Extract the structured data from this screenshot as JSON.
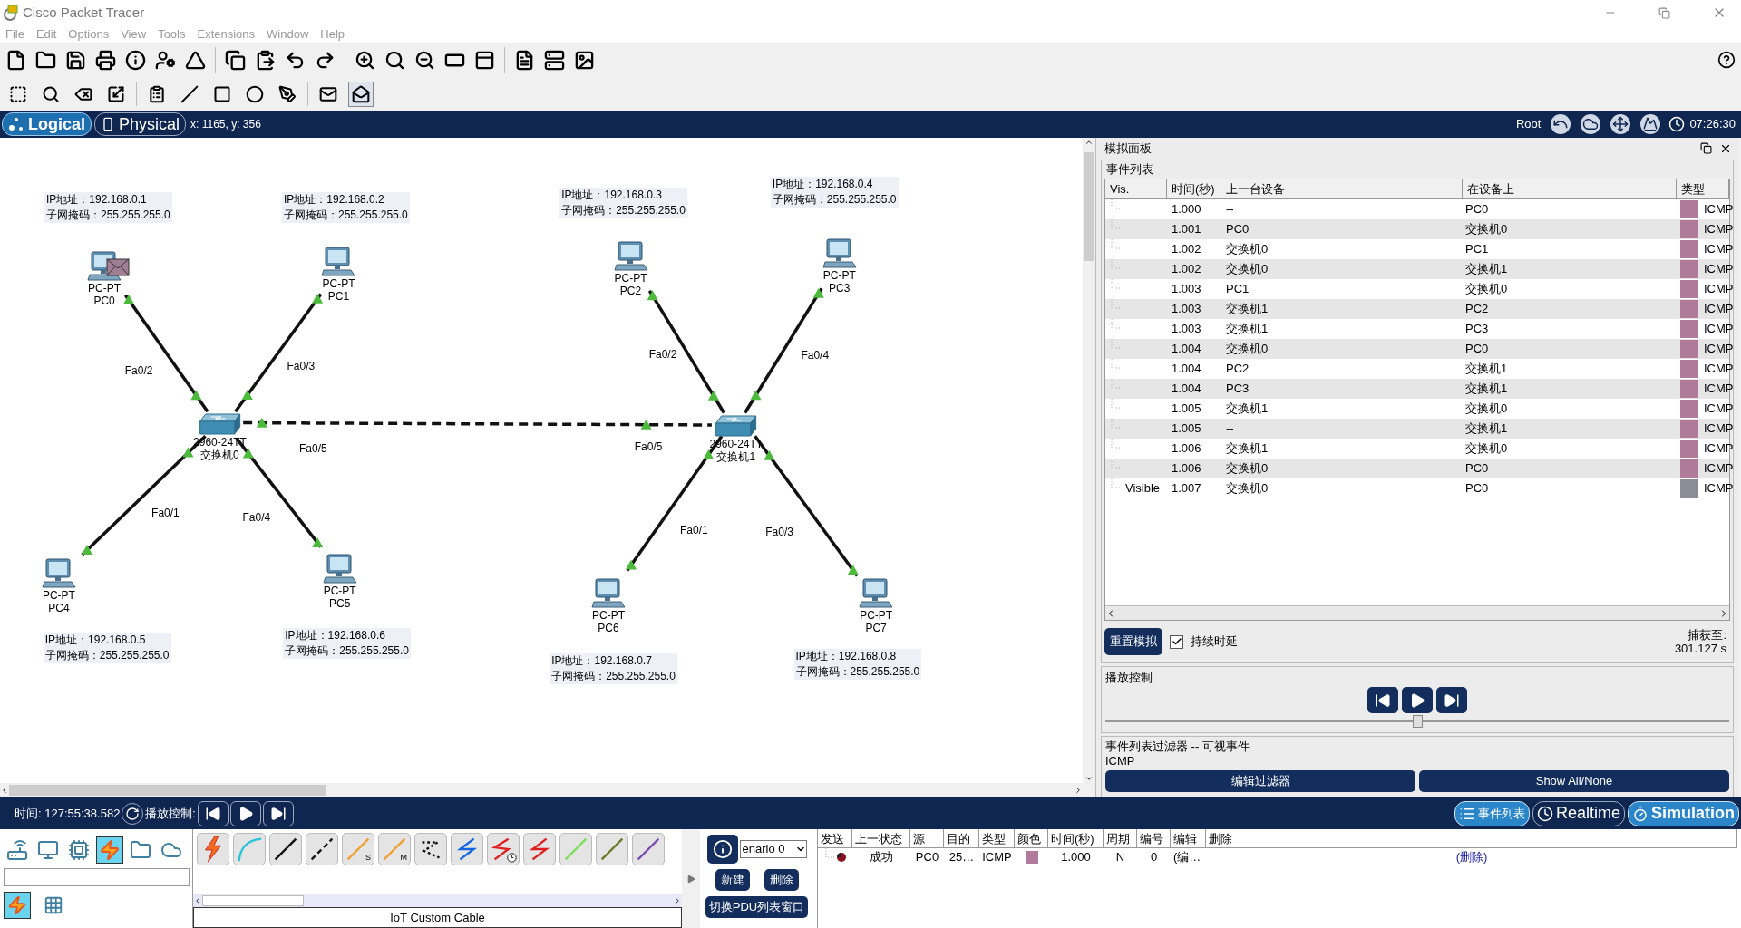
{
  "window": {
    "title": "Cisco Packet Tracer"
  },
  "menu": [
    "File",
    "Edit",
    "Options",
    "View",
    "Tools",
    "Extensions",
    "Window",
    "Help"
  ],
  "drawing_tools": [
    {
      "kind": "select",
      "selected": false
    },
    {
      "kind": "inspect",
      "selected": false
    },
    {
      "kind": "delete",
      "selected": false
    },
    {
      "kind": "resize",
      "selected": false
    },
    {
      "kind": "note",
      "selected": false
    },
    {
      "kind": "line",
      "selected": false
    },
    {
      "kind": "rectangle",
      "selected": false
    },
    {
      "kind": "ellipse",
      "selected": false
    },
    {
      "kind": "freeform",
      "selected": false
    },
    {
      "kind": "simple_pdu",
      "selected": false
    },
    {
      "kind": "complex_pdu",
      "selected": true
    }
  ],
  "workspace_tabs": [
    {
      "label": "Logical",
      "selected": true
    },
    {
      "label": "Physical",
      "selected": false
    }
  ],
  "cursor_position": "x: 1165, y: 356",
  "root_label": "Root",
  "clock": "07:26:30",
  "topology": {
    "nodes": [
      {
        "kind": "pc",
        "model": "PC-PT",
        "name": "PC0",
        "ip": "IP地址：192.168.0.1",
        "mask": "子网掩码：255.255.255.0",
        "envelope": true
      },
      {
        "kind": "pc",
        "model": "PC-PT",
        "name": "PC1",
        "ip": "IP地址：192.168.0.2",
        "mask": "子网掩码：255.255.255.0",
        "envelope": false
      },
      {
        "kind": "pc",
        "model": "PC-PT",
        "name": "PC2",
        "ip": "IP地址：192.168.0.3",
        "mask": "子网掩码：255.255.255.0",
        "envelope": false
      },
      {
        "kind": "pc",
        "model": "PC-PT",
        "name": "PC3",
        "ip": "IP地址：192.168.0.4",
        "mask": "子网掩码：255.255.255.0",
        "envelope": false
      },
      {
        "kind": "pc",
        "model": "PC-PT",
        "name": "PC4",
        "ip": "IP地址：192.168.0.5",
        "mask": "子网掩码：255.255.255.0",
        "envelope": false
      },
      {
        "kind": "pc",
        "model": "PC-PT",
        "name": "PC5",
        "ip": "IP地址：192.168.0.6",
        "mask": "子网掩码：255.255.255.0",
        "envelope": false
      },
      {
        "kind": "pc",
        "model": "PC-PT",
        "name": "PC6",
        "ip": "IP地址：192.168.0.7",
        "mask": "子网掩码：255.255.255.0",
        "envelope": false
      },
      {
        "kind": "pc",
        "model": "PC-PT",
        "name": "PC7",
        "ip": "IP地址：192.168.0.8",
        "mask": "子网掩码：255.255.255.0",
        "envelope": false
      },
      {
        "kind": "switch",
        "model": "2960-24TT",
        "name": "交换机0"
      },
      {
        "kind": "switch",
        "model": "2960-24TT",
        "name": "交换机1"
      }
    ],
    "links": [
      {
        "kind": "straight",
        "labels": [
          "Fa0/2"
        ]
      },
      {
        "kind": "straight",
        "labels": [
          "Fa0/3"
        ]
      },
      {
        "kind": "straight",
        "labels": [
          "Fa0/1"
        ]
      },
      {
        "kind": "straight",
        "labels": [
          "Fa0/4"
        ]
      },
      {
        "kind": "crossover",
        "labels": [
          "Fa0/5",
          "Fa0/5"
        ]
      },
      {
        "kind": "straight",
        "labels": [
          "Fa0/2"
        ]
      },
      {
        "kind": "straight",
        "labels": [
          "Fa0/4"
        ]
      },
      {
        "kind": "straight",
        "labels": [
          "Fa0/1"
        ]
      },
      {
        "kind": "straight",
        "labels": [
          "Fa0/3"
        ]
      }
    ]
  },
  "simulation_panel": {
    "title": "模拟面板",
    "event_list": {
      "title": "事件列表",
      "columns": [
        "Vis.",
        "时间(秒)",
        "上一台设备",
        "在设备上",
        "类型"
      ],
      "rows": [
        {
          "time": "1.000",
          "last_device": "--",
          "at_device": "PC0",
          "color": "#b07a9a",
          "type": "ICMP"
        },
        {
          "time": "1.001",
          "last_device": "PC0",
          "at_device": "交换机0",
          "color": "#b07a9a",
          "type": "ICMP"
        },
        {
          "time": "1.002",
          "last_device": "交换机0",
          "at_device": "PC1",
          "color": "#b07a9a",
          "type": "ICMP"
        },
        {
          "time": "1.002",
          "last_device": "交换机0",
          "at_device": "交换机1",
          "color": "#b07a9a",
          "type": "ICMP"
        },
        {
          "time": "1.003",
          "last_device": "PC1",
          "at_device": "交换机0",
          "color": "#b07a9a",
          "type": "ICMP"
        },
        {
          "time": "1.003",
          "last_device": "交换机1",
          "at_device": "PC2",
          "color": "#b07a9a",
          "type": "ICMP"
        },
        {
          "time": "1.003",
          "last_device": "交换机1",
          "at_device": "PC3",
          "color": "#b07a9a",
          "type": "ICMP"
        },
        {
          "time": "1.004",
          "last_device": "交换机0",
          "at_device": "PC0",
          "color": "#b07a9a",
          "type": "ICMP"
        },
        {
          "time": "1.004",
          "last_device": "PC2",
          "at_device": "交换机1",
          "color": "#b07a9a",
          "type": "ICMP"
        },
        {
          "time": "1.004",
          "last_device": "PC3",
          "at_device": "交换机1",
          "color": "#b07a9a",
          "type": "ICMP"
        },
        {
          "time": "1.005",
          "last_device": "交换机1",
          "at_device": "交换机0",
          "color": "#b07a9a",
          "type": "ICMP"
        },
        {
          "time": "1.005",
          "last_device": "--",
          "at_device": "交换机1",
          "color": "#b07a9a",
          "type": "ICMP"
        },
        {
          "time": "1.006",
          "last_device": "交换机1",
          "at_device": "交换机0",
          "color": "#b07a9a",
          "type": "ICMP"
        },
        {
          "time": "1.006",
          "last_device": "交换机0",
          "at_device": "PC0",
          "color": "#b07a9a",
          "type": "ICMP"
        },
        {
          "vis": "Visible",
          "time": "1.007",
          "last_device": "交换机0",
          "at_device": "PC0",
          "color": "#8c8c96",
          "type": "ICMP"
        }
      ]
    },
    "reset_button": "重置模拟",
    "constant_delay": {
      "label": "持续时延",
      "checked": true
    },
    "captured_label": "捕获至:",
    "captured_time": "301.127 s",
    "playback": {
      "title": "播放控制",
      "level": 0.5
    },
    "filter": {
      "title": "事件列表过滤器 -- 可视事件",
      "value": "ICMP",
      "buttons": [
        "编辑过滤器",
        "Show All/None"
      ]
    }
  },
  "status_bar": {
    "time": "时间: 127:55:38.582",
    "playback_label": "播放控制:",
    "mode_buttons": [
      {
        "kind": "list",
        "label": "事件列表",
        "selected": true
      },
      {
        "kind": "realtime",
        "label": "Realtime",
        "selected": false
      },
      {
        "kind": "simulation",
        "label": "Simulation",
        "selected": true
      }
    ]
  },
  "device_categories": [
    {
      "kind": "network",
      "selected": false
    },
    {
      "kind": "end",
      "selected": false
    },
    {
      "kind": "components",
      "selected": false
    },
    {
      "kind": "connections",
      "selected": true
    },
    {
      "kind": "misc",
      "selected": false
    },
    {
      "kind": "multiuser",
      "selected": false
    }
  ],
  "device_subtypes": [
    {
      "kind": "connections",
      "selected": true
    },
    {
      "kind": "grid",
      "selected": false
    }
  ],
  "cable_palette": {
    "cables": [
      {
        "kind": "auto"
      },
      {
        "kind": "console"
      },
      {
        "kind": "straight"
      },
      {
        "kind": "crossover"
      },
      {
        "kind": "fiber",
        "mark": "S"
      },
      {
        "kind": "fiber",
        "mark": "M"
      },
      {
        "kind": "phone"
      },
      {
        "kind": "coaxial"
      },
      {
        "kind": "serial_dce"
      },
      {
        "kind": "serial_dte"
      },
      {
        "kind": "octal"
      },
      {
        "kind": "iot"
      },
      {
        "kind": "usb"
      }
    ],
    "caption": "IoT Custom Cable"
  },
  "scenario": {
    "select_value": "enario 0",
    "buttons": [
      "新建",
      "删除"
    ],
    "toggle_button": "切换PDU列表窗口"
  },
  "pdu_list": {
    "columns": [
      "发送",
      "上一状态",
      "源",
      "目的",
      "类型",
      "颜色",
      "时间(秒)",
      "周期",
      "编号",
      "编辑",
      "删除"
    ],
    "rows": [
      {
        "last_status": "成功",
        "source": "PC0",
        "destination": "25…",
        "type": "ICMP",
        "color": "#b07a9a",
        "time": "1.000",
        "periodic": "N",
        "number": "0",
        "edit": "(编…",
        "delete": "(删除)"
      }
    ]
  }
}
